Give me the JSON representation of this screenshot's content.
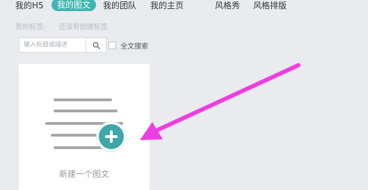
{
  "nav": {
    "items": [
      {
        "label": "我的H5"
      },
      {
        "label": "我的图文"
      },
      {
        "label": "我的团队"
      },
      {
        "label": "我的主页"
      },
      {
        "label": "风格秀"
      },
      {
        "label": "风格排版"
      }
    ],
    "active_index": 1
  },
  "tags": {
    "label": "我的标签:",
    "empty_text": "还没有创建标签"
  },
  "search": {
    "placeholder": "输入标题或描述",
    "fulltext_label": "全文搜索",
    "fulltext_checked": false
  },
  "card": {
    "label": "新建一个图文"
  },
  "colors": {
    "accent": "#3fb5b0",
    "annotation_arrow": "#ee3ee0"
  },
  "icons": {
    "search": "search-icon",
    "plus": "plus-circle-icon",
    "document": "document-lines-icon"
  }
}
